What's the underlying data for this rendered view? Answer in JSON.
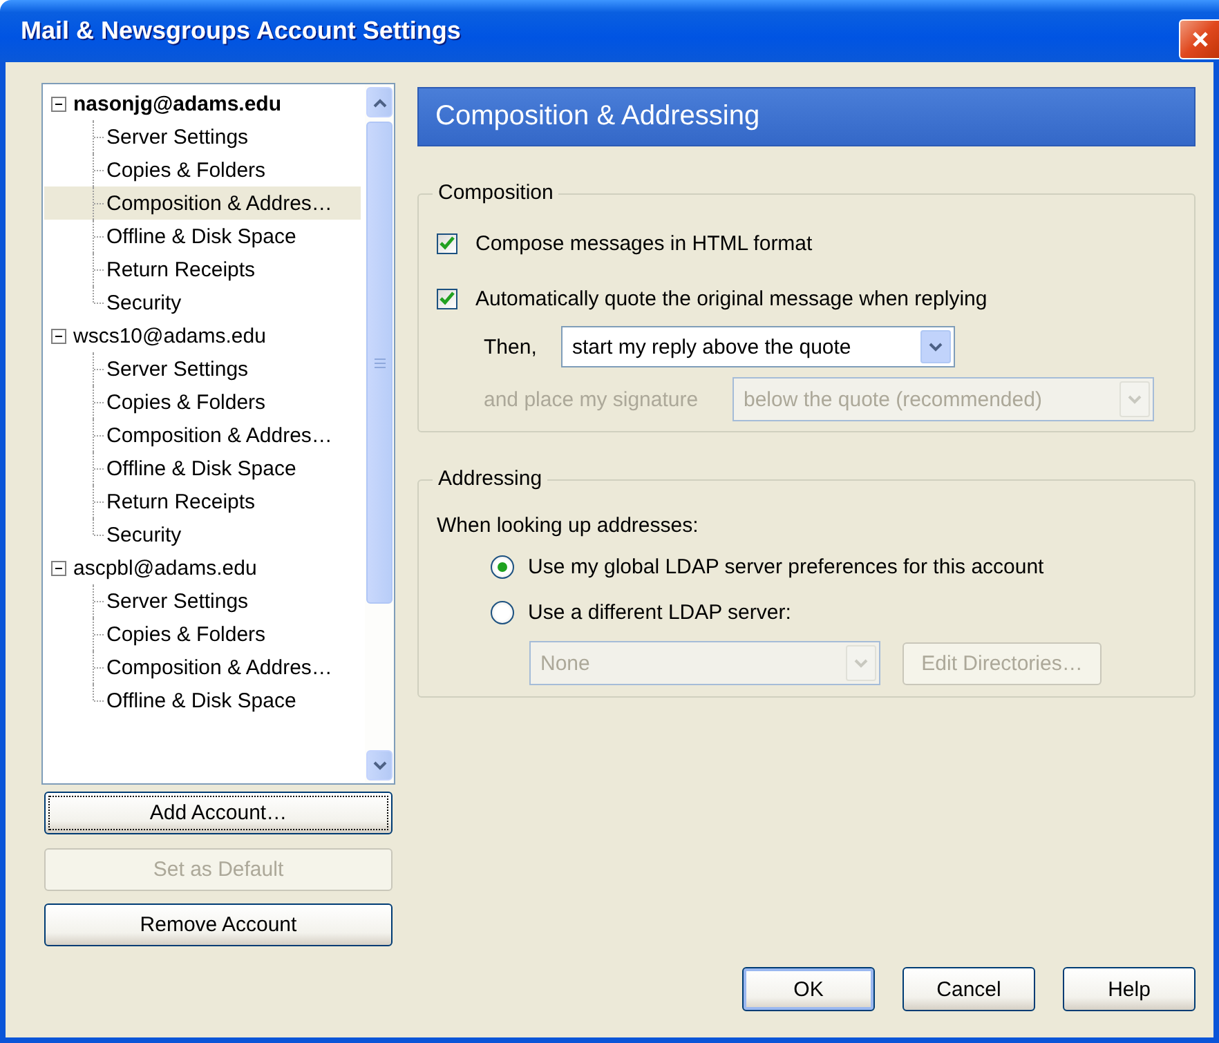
{
  "window": {
    "title": "Mail & Newsgroups Account Settings"
  },
  "account_tree": [
    {
      "label": "nasonjg@adams.edu",
      "default": true,
      "expanded": true,
      "children": [
        {
          "label": "Server Settings",
          "selected": false
        },
        {
          "label": "Copies & Folders",
          "selected": false
        },
        {
          "label": "Composition & Addres…",
          "selected": true
        },
        {
          "label": "Offline & Disk Space",
          "selected": false
        },
        {
          "label": "Return Receipts",
          "selected": false
        },
        {
          "label": "Security",
          "selected": false
        }
      ]
    },
    {
      "label": "wscs10@adams.edu",
      "default": false,
      "expanded": true,
      "children": [
        {
          "label": "Server Settings",
          "selected": false
        },
        {
          "label": "Copies & Folders",
          "selected": false
        },
        {
          "label": "Composition & Addres…",
          "selected": false
        },
        {
          "label": "Offline & Disk Space",
          "selected": false
        },
        {
          "label": "Return Receipts",
          "selected": false
        },
        {
          "label": "Security",
          "selected": false
        }
      ]
    },
    {
      "label": "ascpbl@adams.edu",
      "default": false,
      "expanded": true,
      "children": [
        {
          "label": "Server Settings",
          "selected": false
        },
        {
          "label": "Copies & Folders",
          "selected": false
        },
        {
          "label": "Composition & Addres…",
          "selected": false
        },
        {
          "label": "Offline & Disk Space",
          "selected": false
        }
      ]
    }
  ],
  "account_buttons": [
    {
      "label": "Add Account…",
      "disabled": false,
      "focused": true
    },
    {
      "label": "Set as Default",
      "disabled": true,
      "focused": false
    },
    {
      "label": "Remove Account",
      "disabled": false,
      "focused": false
    }
  ],
  "panel_title": "Composition & Addressing",
  "composition": {
    "legend": "Composition",
    "checkboxes": [
      {
        "label": "Compose messages in HTML format",
        "checked": true
      },
      {
        "label": "Automatically quote the original message when replying",
        "checked": true
      }
    ],
    "reply_position": {
      "label": "Then,",
      "value": "start my reply above the quote",
      "disabled": false
    },
    "signature_position": {
      "label": "and place my signature",
      "value": "below the quote (recommended)",
      "disabled": true
    }
  },
  "addressing": {
    "legend": "Addressing",
    "prompt": "When looking up addresses:",
    "options": [
      {
        "label": "Use my global LDAP server preferences for this account",
        "selected": true
      },
      {
        "label": "Use a different LDAP server:",
        "selected": false
      }
    ],
    "ldap_server": {
      "value": "None",
      "disabled": true
    },
    "edit_button": {
      "label": "Edit Directories…",
      "disabled": true
    }
  },
  "dialog_buttons": [
    {
      "label": "OK",
      "default": true
    },
    {
      "label": "Cancel",
      "default": false
    },
    {
      "label": "Help",
      "default": false
    }
  ]
}
